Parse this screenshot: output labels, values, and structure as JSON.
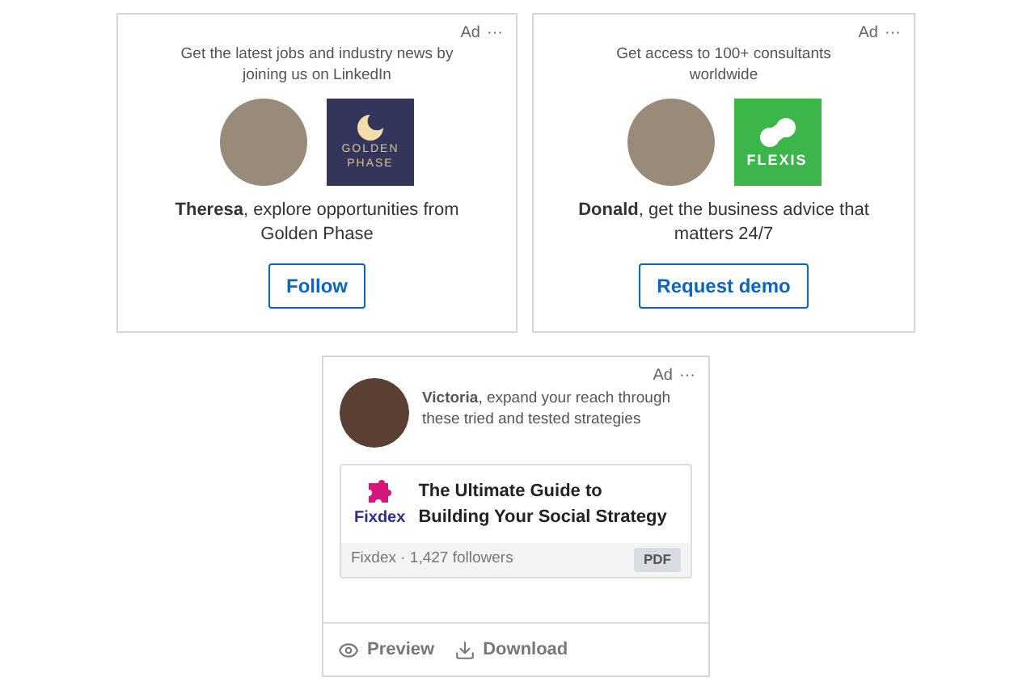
{
  "cards": [
    {
      "ad_label": "Ad",
      "more": "···",
      "tagline": "Get the latest jobs and industry news by joining us on LinkedIn",
      "logo": {
        "kind": "golden",
        "lines": [
          "GOLDEN",
          "PHASE"
        ]
      },
      "message": "**Theresa**, explore opportunities from Golden Phase",
      "button": "Follow"
    },
    {
      "ad_label": "Ad",
      "more": "···",
      "tagline": "Get access to 100+ consultants worldwide",
      "logo": {
        "kind": "flexis",
        "lines": [
          "FLEXIS"
        ]
      },
      "message": "**Donald**, get the business advice that matters 24/7",
      "button": "Request demo"
    }
  ],
  "document_ad": {
    "ad_label": "Ad",
    "more": "···",
    "message": "**Victoria**, expand your reach through these tried and tested strategies",
    "logo_text": "Fixdex",
    "title": "The Ultimate Guide to Building Your Social Strategy",
    "meta": "Fixdex · 1,427 followers",
    "badge": "PDF",
    "actions": [
      {
        "kind": "preview",
        "label": "Preview"
      },
      {
        "kind": "download",
        "label": "Download"
      }
    ]
  }
}
